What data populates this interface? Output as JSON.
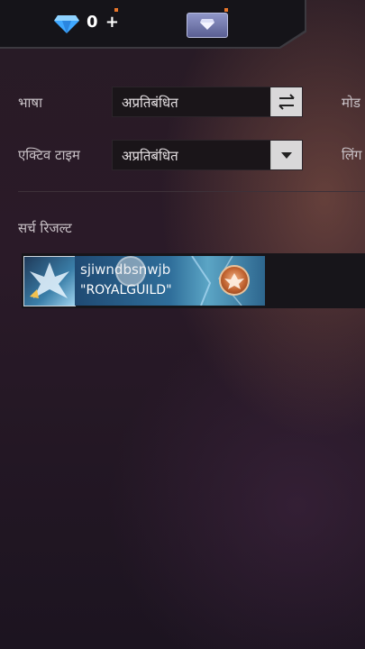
{
  "topbar": {
    "diamond_count": "0",
    "add_label": "+"
  },
  "filters": {
    "language_label": "भाषा",
    "language_value": "अप्रतिबंधित",
    "active_time_label": "एक्टिव टाइम",
    "active_time_value": "अप्रतिबंधित",
    "mode_label": "मोड",
    "gender_label": "लिंग"
  },
  "search": {
    "results_label": "सर्च रिजल्ट",
    "results": [
      {
        "player_name": "sjiwndbsnwjb",
        "guild_name": "\"ROYALGUILD\""
      }
    ]
  },
  "colors": {
    "accent_orange": "#e8762a",
    "diamond_blue": "#3fa8ff",
    "banner_blue": "#2f6e9a"
  }
}
